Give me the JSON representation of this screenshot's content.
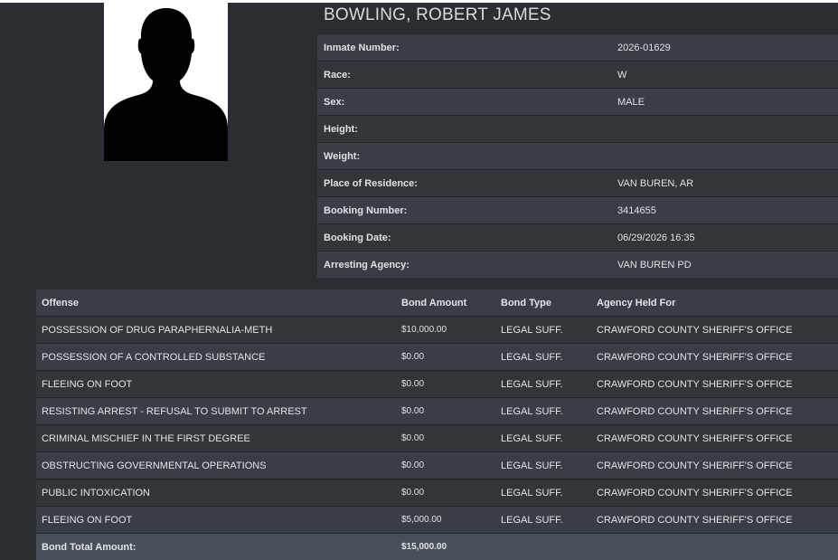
{
  "inmate": {
    "name": "BOWLING, ROBERT JAMES",
    "photo_icon": "person-silhouette-icon"
  },
  "details": [
    {
      "label": "Inmate Number:",
      "value": "2026-01629"
    },
    {
      "label": "Race:",
      "value": "W"
    },
    {
      "label": "Sex:",
      "value": "MALE"
    },
    {
      "label": "Height:",
      "value": ""
    },
    {
      "label": "Weight:",
      "value": ""
    },
    {
      "label": "Place of Residence:",
      "value": "VAN BUREN, AR"
    },
    {
      "label": "Booking Number:",
      "value": "3414655"
    },
    {
      "label": "Booking Date:",
      "value": "06/29/2026 16:35"
    },
    {
      "label": "Arresting Agency:",
      "value": "VAN BUREN PD"
    }
  ],
  "charges": {
    "headers": {
      "offense": "Offense",
      "bond_amount": "Bond Amount",
      "bond_type": "Bond Type",
      "agency": "Agency Held For"
    },
    "rows": [
      {
        "offense": "POSSESSION OF DRUG PARAPHERNALIA-METH",
        "bond_amount": "$10,000.00",
        "bond_type": "LEGAL SUFF.",
        "agency": "CRAWFORD COUNTY SHERIFF'S OFFICE"
      },
      {
        "offense": "POSSESSION OF A CONTROLLED SUBSTANCE",
        "bond_amount": "$0.00",
        "bond_type": "LEGAL SUFF.",
        "agency": "CRAWFORD COUNTY SHERIFF'S OFFICE"
      },
      {
        "offense": "FLEEING ON FOOT",
        "bond_amount": "$0.00",
        "bond_type": "LEGAL SUFF.",
        "agency": "CRAWFORD COUNTY SHERIFF'S OFFICE"
      },
      {
        "offense": "RESISTING ARREST - REFUSAL TO SUBMIT TO ARREST",
        "bond_amount": "$0.00",
        "bond_type": "LEGAL SUFF.",
        "agency": "CRAWFORD COUNTY SHERIFF'S OFFICE"
      },
      {
        "offense": "CRIMINAL MISCHIEF IN THE FIRST DEGREE",
        "bond_amount": "$0.00",
        "bond_type": "LEGAL SUFF.",
        "agency": "CRAWFORD COUNTY SHERIFF'S OFFICE"
      },
      {
        "offense": "OBSTRUCTING GOVERNMENTAL OPERATIONS",
        "bond_amount": "$0.00",
        "bond_type": "LEGAL SUFF.",
        "agency": "CRAWFORD COUNTY SHERIFF'S OFFICE"
      },
      {
        "offense": "PUBLIC INTOXICATION",
        "bond_amount": "$0.00",
        "bond_type": "LEGAL SUFF.",
        "agency": "CRAWFORD COUNTY SHERIFF'S OFFICE"
      },
      {
        "offense": "FLEEING ON FOOT",
        "bond_amount": "$5,000.00",
        "bond_type": "LEGAL SUFF.",
        "agency": "CRAWFORD COUNTY SHERIFF'S OFFICE"
      }
    ],
    "total": {
      "label": "Bond Total Amount:",
      "value": "$15,000.00"
    }
  }
}
